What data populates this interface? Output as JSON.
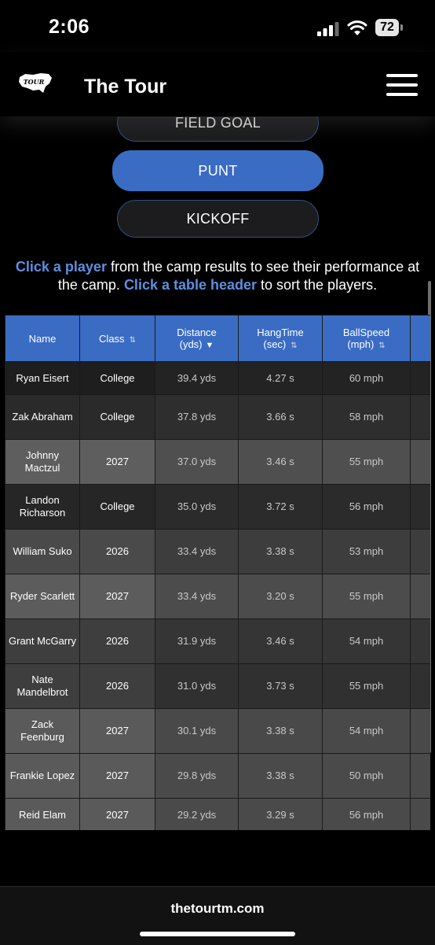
{
  "status": {
    "time": "2:06",
    "battery": "72"
  },
  "header": {
    "logo_text": "TOUR",
    "title": "The Tour"
  },
  "tabs": [
    {
      "label": "FIELD GOAL",
      "active": false
    },
    {
      "label": "PUNT",
      "active": true
    },
    {
      "label": "KICKOFF",
      "active": false
    }
  ],
  "instructions": {
    "link1": "Click a player",
    "text1": " from the camp results to see their performance at the camp. ",
    "link2": "Click a table header",
    "text2": " to sort the players."
  },
  "table": {
    "columns": [
      {
        "label": "Name",
        "sub": "",
        "sort": ""
      },
      {
        "label": "Class",
        "sub": "",
        "sort": "⇅"
      },
      {
        "label": "Distance",
        "sub": "(yds)",
        "sort": "▼"
      },
      {
        "label": "HangTime",
        "sub": "(sec)",
        "sort": "⇅"
      },
      {
        "label": "BallSpeed",
        "sub": "(mph)",
        "sort": "⇅"
      }
    ],
    "rows": [
      [
        "Ryan Eisert",
        "College",
        "39.4 yds",
        "4.27 s",
        "60 mph"
      ],
      [
        "Zak Abraham",
        "College",
        "37.8 yds",
        "3.66 s",
        "58 mph"
      ],
      [
        "Johnny Mactzul",
        "2027",
        "37.0 yds",
        "3.46 s",
        "55 mph"
      ],
      [
        "Landon Richarson",
        "College",
        "35.0 yds",
        "3.72 s",
        "56 mph"
      ],
      [
        "William Suko",
        "2026",
        "33.4 yds",
        "3.38 s",
        "53 mph"
      ],
      [
        "Ryder Scarlett",
        "2027",
        "33.4 yds",
        "3.20 s",
        "55 mph"
      ],
      [
        "Grant McGarry",
        "2026",
        "31.9 yds",
        "3.46 s",
        "54 mph"
      ],
      [
        "Nate Mandelbrot",
        "2026",
        "31.0 yds",
        "3.73 s",
        "55 mph"
      ],
      [
        "Zack Feenburg",
        "2027",
        "30.1 yds",
        "3.38 s",
        "54 mph"
      ],
      [
        "Frankie Lopez",
        "2027",
        "29.8 yds",
        "3.38 s",
        "50 mph"
      ],
      [
        "Reid Elam",
        "2027",
        "29.2 yds",
        "3.29 s",
        "56 mph"
      ]
    ]
  },
  "footer": {
    "url": "thetourtm.com"
  },
  "colors": {
    "accent": "#3a6cc4",
    "link": "#5c8fe0",
    "background": "#000000"
  }
}
